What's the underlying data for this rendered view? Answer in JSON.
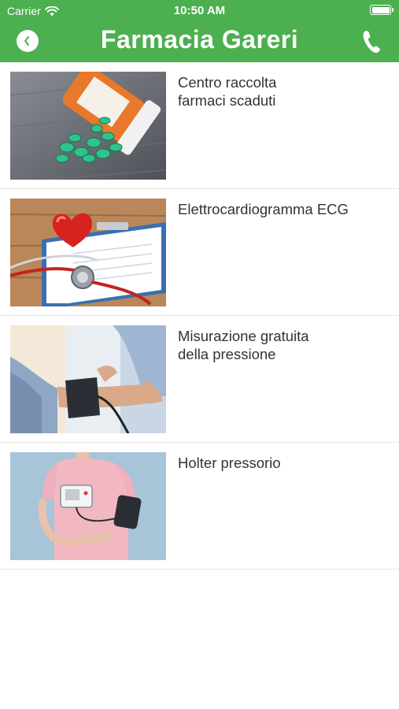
{
  "status_bar": {
    "carrier": "Carrier",
    "time": "10:50 AM"
  },
  "header": {
    "title": "Farmacia Gareri",
    "back_icon": "chevron-left-icon",
    "call_icon": "phone-icon"
  },
  "colors": {
    "header_bg": "#4caf50",
    "text": "#333333",
    "divider": "#e6e6e6"
  },
  "services": [
    {
      "title": "Centro raccolta\nfarmaci scaduti",
      "image": "pill-bottle-image"
    },
    {
      "title": "Elettrocardiogramma ECG",
      "image": "heart-stethoscope-image"
    },
    {
      "title": "Misurazione gratuita\ndella pressione",
      "image": "blood-pressure-cuff-image"
    },
    {
      "title": "Holter pressorio",
      "image": "blood-pressure-monitor-image"
    }
  ]
}
